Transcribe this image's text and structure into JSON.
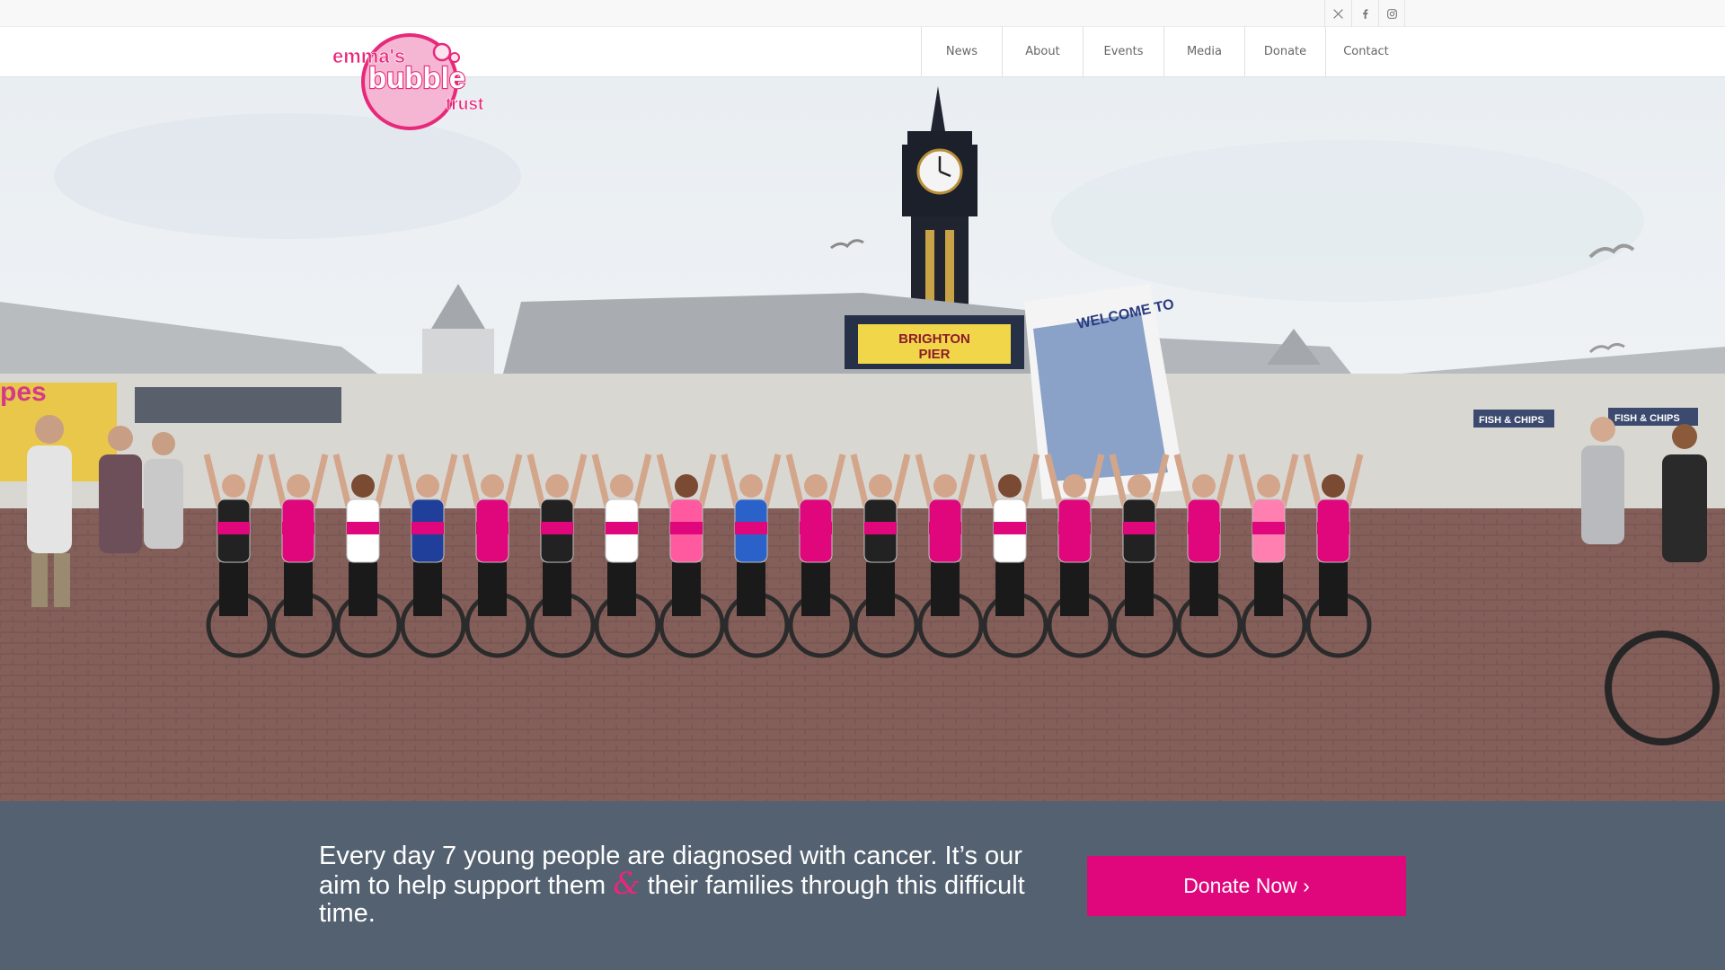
{
  "social": [
    {
      "icon": "x-twitter-icon"
    },
    {
      "icon": "facebook-icon"
    },
    {
      "icon": "instagram-icon"
    }
  ],
  "logo": {
    "line1": "emma's",
    "line2": "bubble",
    "line3": "trust",
    "color": "#e8287a"
  },
  "nav": [
    {
      "label": "News"
    },
    {
      "label": "About"
    },
    {
      "label": "Events"
    },
    {
      "label": "Media"
    },
    {
      "label": "Donate"
    },
    {
      "label": "Contact"
    }
  ],
  "hero": {
    "sign_line1": "BRIGHTON",
    "sign_line2": "PIER",
    "banner": "WELCOME TO",
    "kiosk_left": "pes",
    "stall_right1": "FISH & CHIPS",
    "stall_right2": "FISH & CHIPS"
  },
  "band": {
    "tagline_part1": "Every day 7 young people are diagnosed with cancer. It’s our aim to help support them",
    "tagline_amp": "&",
    "tagline_part2": "their families through this difficult time.",
    "donate_label": "Donate Now ›",
    "background": "#546170",
    "accent": "#e0077c"
  }
}
